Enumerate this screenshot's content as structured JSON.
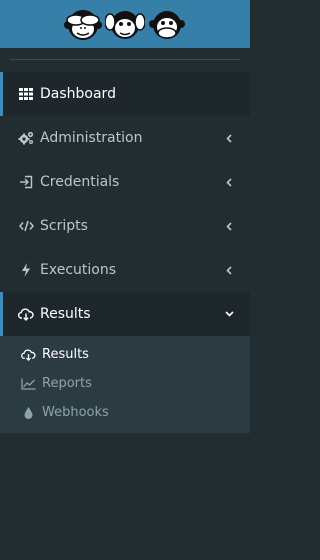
{
  "brand": {
    "logo_icon": "three-wise-monkeys-logo",
    "background_color": "#367fa9"
  },
  "sidebar": {
    "background_color": "#222d32",
    "accent_color": "#3c8dbc",
    "items": [
      {
        "label": "Dashboard",
        "icon": "grid-icon",
        "active": true,
        "has_children": false
      },
      {
        "label": "Administration",
        "icon": "cogs-icon",
        "has_children": true
      },
      {
        "label": "Credentials",
        "icon": "sign-in-icon",
        "has_children": true
      },
      {
        "label": "Scripts",
        "icon": "code-icon",
        "has_children": true
      },
      {
        "label": "Executions",
        "icon": "bolt-icon",
        "has_children": true
      },
      {
        "label": "Results",
        "icon": "cloud-download-icon",
        "has_children": true,
        "expanded": true
      }
    ],
    "results_submenu": [
      {
        "label": "Results",
        "icon": "cloud-download-icon",
        "current": true
      },
      {
        "label": "Reports",
        "icon": "line-chart-icon"
      },
      {
        "label": "Webhooks",
        "icon": "tint-icon"
      }
    ]
  }
}
